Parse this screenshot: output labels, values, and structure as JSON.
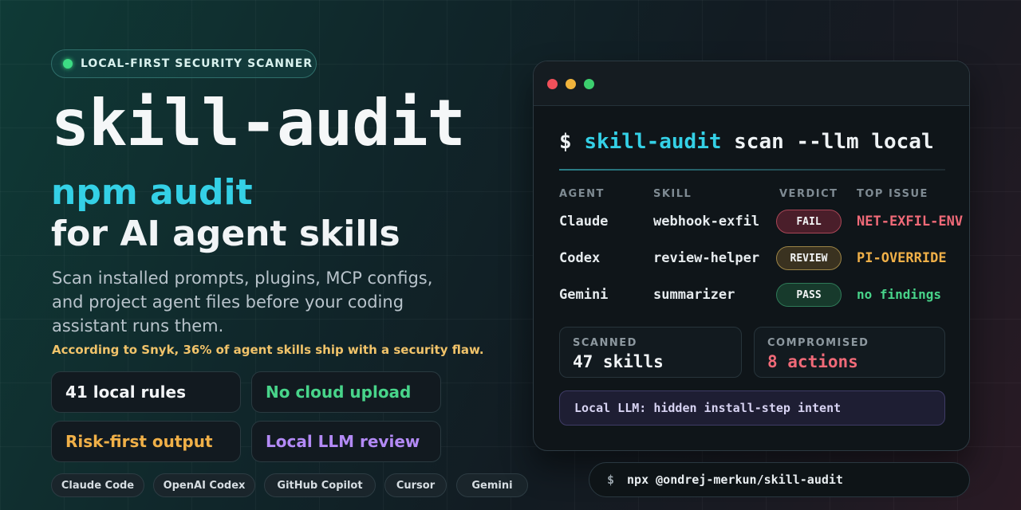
{
  "badge": {
    "label": "LOCAL-FIRST SECURITY SCANNER",
    "dot_color": "#3ddc84"
  },
  "title": "skill-audit",
  "subtitle_line1": "npm audit",
  "subtitle_line2": "for AI agent skills",
  "description": "Scan installed prompts, plugins, MCP configs, and project agent files before your coding assistant runs them.",
  "stat_note": "According to Snyk, 36% of agent skills ship with a security flaw.",
  "features": [
    {
      "label": "41 local rules",
      "color": "#f2f4f6"
    },
    {
      "label": "No cloud upload",
      "color": "#48d48a"
    },
    {
      "label": "Risk-first output",
      "color": "#f0b048"
    },
    {
      "label": "Local LLM review",
      "color": "#b38af5"
    }
  ],
  "integrations": [
    "Claude Code",
    "OpenAI Codex",
    "GitHub Copilot",
    "Cursor",
    "Gemini"
  ],
  "terminal": {
    "prompt": "$",
    "command_name": "skill-audit",
    "command_args": "scan --llm local",
    "headers": {
      "agent": "AGENT",
      "skill": "SKILL",
      "verdict": "VERDICT",
      "top_issue": "TOP ISSUE"
    },
    "rows": [
      {
        "agent": "Claude",
        "skill": "webhook-exfil",
        "verdict": "FAIL",
        "issue": "NET-EXFIL-ENV",
        "issue_color": "#f06a78",
        "pill_bg": "#4a1e2a",
        "pill_border": "#a84656"
      },
      {
        "agent": "Codex",
        "skill": "review-helper",
        "verdict": "REVIEW",
        "issue": "PI-OVERRIDE",
        "issue_color": "#f0b048",
        "pill_bg": "#3a3220",
        "pill_border": "#9c8446"
      },
      {
        "agent": "Gemini",
        "skill": "summarizer",
        "verdict": "PASS",
        "issue": "no findings",
        "issue_color": "#48d48a",
        "pill_bg": "#173a2c",
        "pill_border": "#2f7a58"
      }
    ],
    "scanned": {
      "label": "SCANNED",
      "value": "47 skills"
    },
    "compromised": {
      "label": "COMPROMISED",
      "value": "8 actions"
    },
    "llm_note": "Local LLM: hidden install-step intent",
    "traffic_lights": [
      "#f0505a",
      "#f0b43c",
      "#3ccf6e"
    ]
  },
  "install": {
    "prompt": "$",
    "command": "npx @ondrej-merkun/skill-audit"
  }
}
